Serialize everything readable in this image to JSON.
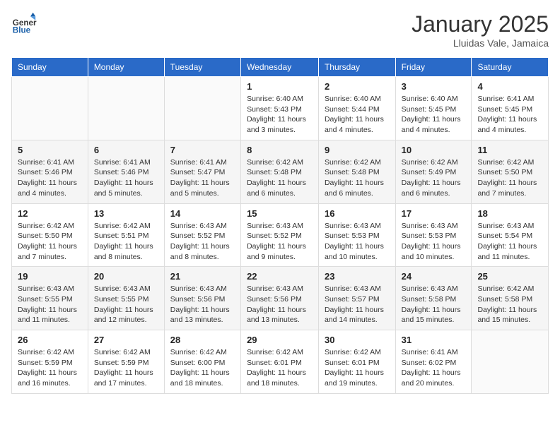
{
  "logo": {
    "general": "General",
    "blue": "Blue"
  },
  "header": {
    "month": "January 2025",
    "location": "Lluidas Vale, Jamaica"
  },
  "weekdays": [
    "Sunday",
    "Monday",
    "Tuesday",
    "Wednesday",
    "Thursday",
    "Friday",
    "Saturday"
  ],
  "weeks": [
    [
      {
        "day": "",
        "info": ""
      },
      {
        "day": "",
        "info": ""
      },
      {
        "day": "",
        "info": ""
      },
      {
        "day": "1",
        "info": "Sunrise: 6:40 AM\nSunset: 5:43 PM\nDaylight: 11 hours\nand 3 minutes."
      },
      {
        "day": "2",
        "info": "Sunrise: 6:40 AM\nSunset: 5:44 PM\nDaylight: 11 hours\nand 4 minutes."
      },
      {
        "day": "3",
        "info": "Sunrise: 6:40 AM\nSunset: 5:45 PM\nDaylight: 11 hours\nand 4 minutes."
      },
      {
        "day": "4",
        "info": "Sunrise: 6:41 AM\nSunset: 5:45 PM\nDaylight: 11 hours\nand 4 minutes."
      }
    ],
    [
      {
        "day": "5",
        "info": "Sunrise: 6:41 AM\nSunset: 5:46 PM\nDaylight: 11 hours\nand 4 minutes."
      },
      {
        "day": "6",
        "info": "Sunrise: 6:41 AM\nSunset: 5:46 PM\nDaylight: 11 hours\nand 5 minutes."
      },
      {
        "day": "7",
        "info": "Sunrise: 6:41 AM\nSunset: 5:47 PM\nDaylight: 11 hours\nand 5 minutes."
      },
      {
        "day": "8",
        "info": "Sunrise: 6:42 AM\nSunset: 5:48 PM\nDaylight: 11 hours\nand 6 minutes."
      },
      {
        "day": "9",
        "info": "Sunrise: 6:42 AM\nSunset: 5:48 PM\nDaylight: 11 hours\nand 6 minutes."
      },
      {
        "day": "10",
        "info": "Sunrise: 6:42 AM\nSunset: 5:49 PM\nDaylight: 11 hours\nand 6 minutes."
      },
      {
        "day": "11",
        "info": "Sunrise: 6:42 AM\nSunset: 5:50 PM\nDaylight: 11 hours\nand 7 minutes."
      }
    ],
    [
      {
        "day": "12",
        "info": "Sunrise: 6:42 AM\nSunset: 5:50 PM\nDaylight: 11 hours\nand 7 minutes."
      },
      {
        "day": "13",
        "info": "Sunrise: 6:42 AM\nSunset: 5:51 PM\nDaylight: 11 hours\nand 8 minutes."
      },
      {
        "day": "14",
        "info": "Sunrise: 6:43 AM\nSunset: 5:52 PM\nDaylight: 11 hours\nand 8 minutes."
      },
      {
        "day": "15",
        "info": "Sunrise: 6:43 AM\nSunset: 5:52 PM\nDaylight: 11 hours\nand 9 minutes."
      },
      {
        "day": "16",
        "info": "Sunrise: 6:43 AM\nSunset: 5:53 PM\nDaylight: 11 hours\nand 10 minutes."
      },
      {
        "day": "17",
        "info": "Sunrise: 6:43 AM\nSunset: 5:53 PM\nDaylight: 11 hours\nand 10 minutes."
      },
      {
        "day": "18",
        "info": "Sunrise: 6:43 AM\nSunset: 5:54 PM\nDaylight: 11 hours\nand 11 minutes."
      }
    ],
    [
      {
        "day": "19",
        "info": "Sunrise: 6:43 AM\nSunset: 5:55 PM\nDaylight: 11 hours\nand 11 minutes."
      },
      {
        "day": "20",
        "info": "Sunrise: 6:43 AM\nSunset: 5:55 PM\nDaylight: 11 hours\nand 12 minutes."
      },
      {
        "day": "21",
        "info": "Sunrise: 6:43 AM\nSunset: 5:56 PM\nDaylight: 11 hours\nand 13 minutes."
      },
      {
        "day": "22",
        "info": "Sunrise: 6:43 AM\nSunset: 5:56 PM\nDaylight: 11 hours\nand 13 minutes."
      },
      {
        "day": "23",
        "info": "Sunrise: 6:43 AM\nSunset: 5:57 PM\nDaylight: 11 hours\nand 14 minutes."
      },
      {
        "day": "24",
        "info": "Sunrise: 6:43 AM\nSunset: 5:58 PM\nDaylight: 11 hours\nand 15 minutes."
      },
      {
        "day": "25",
        "info": "Sunrise: 6:42 AM\nSunset: 5:58 PM\nDaylight: 11 hours\nand 15 minutes."
      }
    ],
    [
      {
        "day": "26",
        "info": "Sunrise: 6:42 AM\nSunset: 5:59 PM\nDaylight: 11 hours\nand 16 minutes."
      },
      {
        "day": "27",
        "info": "Sunrise: 6:42 AM\nSunset: 5:59 PM\nDaylight: 11 hours\nand 17 minutes."
      },
      {
        "day": "28",
        "info": "Sunrise: 6:42 AM\nSunset: 6:00 PM\nDaylight: 11 hours\nand 18 minutes."
      },
      {
        "day": "29",
        "info": "Sunrise: 6:42 AM\nSunset: 6:01 PM\nDaylight: 11 hours\nand 18 minutes."
      },
      {
        "day": "30",
        "info": "Sunrise: 6:42 AM\nSunset: 6:01 PM\nDaylight: 11 hours\nand 19 minutes."
      },
      {
        "day": "31",
        "info": "Sunrise: 6:41 AM\nSunset: 6:02 PM\nDaylight: 11 hours\nand 20 minutes."
      },
      {
        "day": "",
        "info": ""
      }
    ]
  ]
}
